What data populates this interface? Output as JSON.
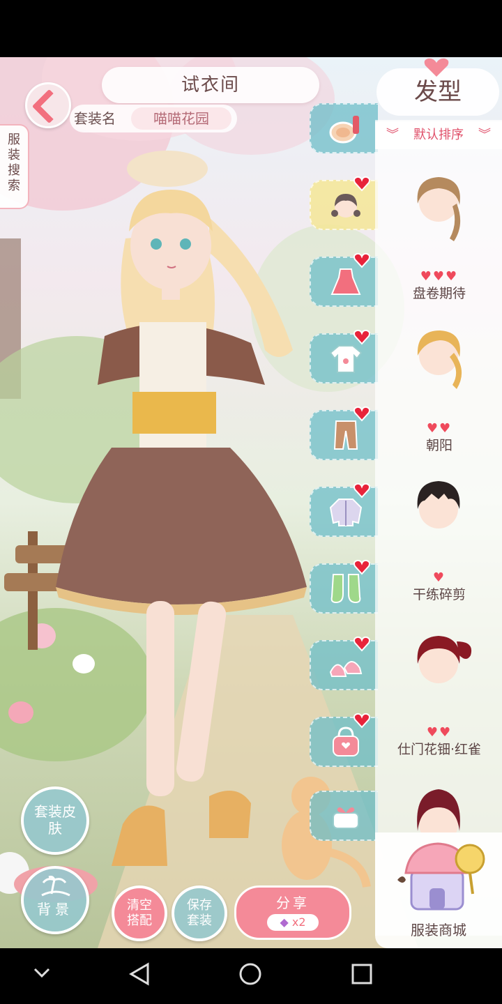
{
  "header": {
    "title": "试衣间",
    "suit_label": "套装名",
    "suit_name": "喵喵花园"
  },
  "search_tab": {
    "label": "服装搜索"
  },
  "categories": [
    {
      "name": "makeup",
      "icon": "makeup-compact-icon",
      "active": false,
      "has_new": false
    },
    {
      "name": "hair",
      "icon": "hair-icon",
      "active": true,
      "has_new": true
    },
    {
      "name": "dress",
      "icon": "dress-icon",
      "active": false,
      "has_new": true
    },
    {
      "name": "top",
      "icon": "tshirt-icon",
      "active": false,
      "has_new": true
    },
    {
      "name": "bottom",
      "icon": "pants-icon",
      "active": false,
      "has_new": true
    },
    {
      "name": "coat",
      "icon": "jacket-icon",
      "active": false,
      "has_new": true
    },
    {
      "name": "socks",
      "icon": "socks-icon",
      "active": false,
      "has_new": true
    },
    {
      "name": "shoes",
      "icon": "heels-icon",
      "active": false,
      "has_new": true
    },
    {
      "name": "accessory",
      "icon": "handbag-icon",
      "active": false,
      "has_new": true
    },
    {
      "name": "special",
      "icon": "gift-box-icon",
      "active": false,
      "has_new": false
    }
  ],
  "panel": {
    "title": "发型",
    "sort_label": "默认排序",
    "items": [
      {
        "name": "盘卷期待",
        "hearts": "♥♥♥",
        "hair_color": "#b58a5e"
      },
      {
        "name": "朝阳",
        "hearts": "♥♥",
        "hair_color": "#e8b458"
      },
      {
        "name": "干练碎剪",
        "hearts": "♥",
        "hair_color": "#2a2222"
      },
      {
        "name": "仕门花钿·红雀",
        "hearts": "♥♥",
        "hair_color": "#8a1a24"
      },
      {
        "name": "",
        "hearts": "",
        "hair_color": "#7a1c2a"
      }
    ],
    "shop_label": "服装商城"
  },
  "bottom_buttons": {
    "skin": "套装皮肤",
    "background": "背景",
    "clear": "清空搭配",
    "save": "保存套装",
    "share": "分享",
    "share_count": "x2"
  },
  "colors": {
    "accent": "#f26f7e",
    "tab_teal": "#6ebec8",
    "panel_text": "#6b4a4a"
  }
}
